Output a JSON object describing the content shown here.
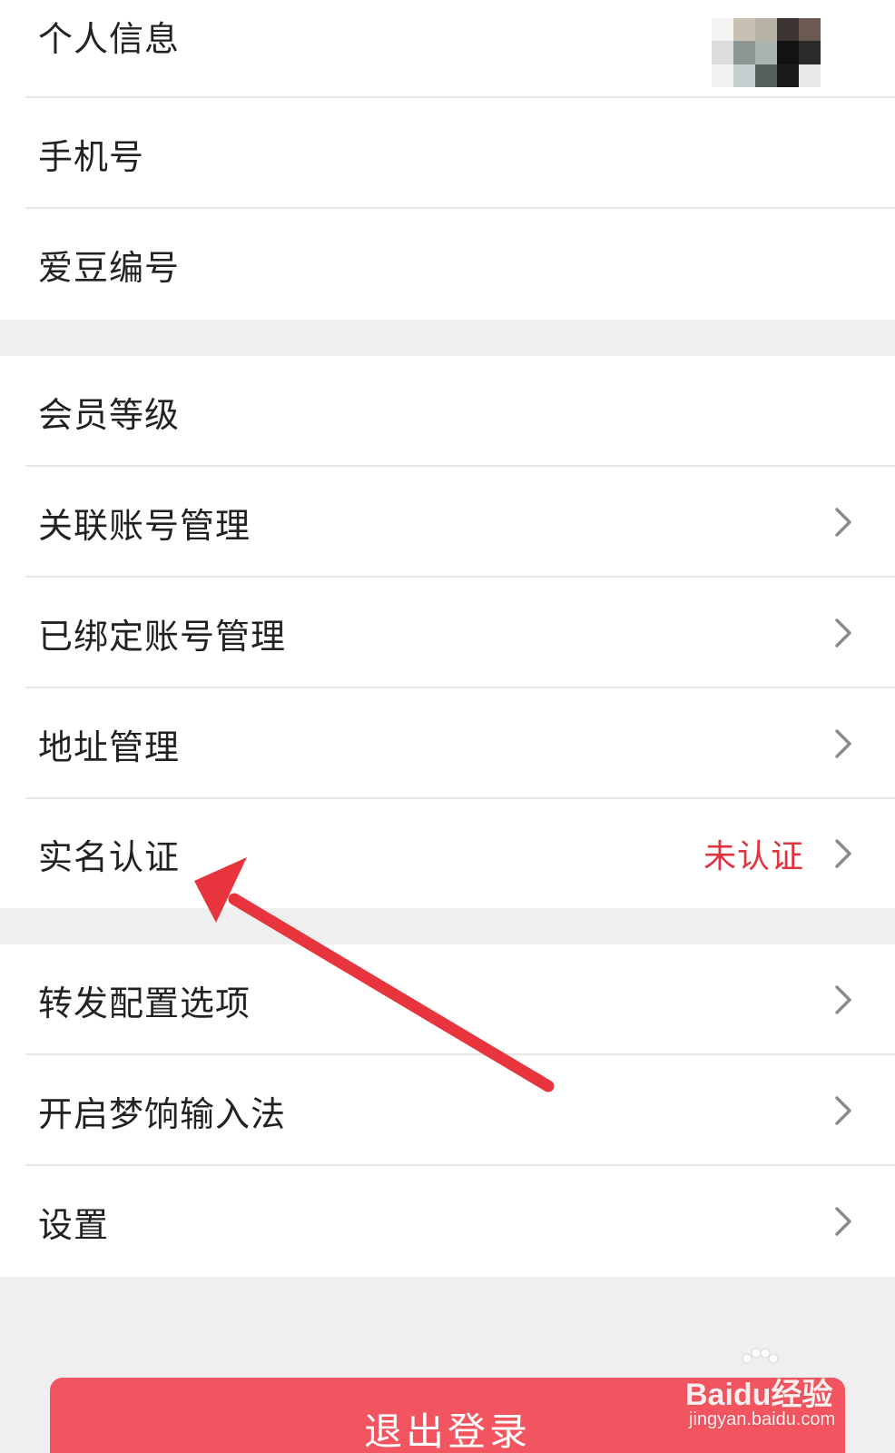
{
  "profile_section": {
    "items": [
      {
        "label": "个人信息"
      },
      {
        "label": "手机号"
      },
      {
        "label": "爱豆编号"
      }
    ]
  },
  "account_section": {
    "items": [
      {
        "label": "会员等级"
      },
      {
        "label": "关联账号管理"
      },
      {
        "label": "已绑定账号管理"
      },
      {
        "label": "地址管理"
      },
      {
        "label": "实名认证",
        "status": "未认证"
      }
    ]
  },
  "other_section": {
    "items": [
      {
        "label": "转发配置选项"
      },
      {
        "label": "开启梦饷输入法"
      },
      {
        "label": "设置"
      }
    ]
  },
  "logout_button": {
    "label": "退出登录"
  },
  "watermark": {
    "brand": "Baidu经验",
    "url": "jingyan.baidu.com"
  },
  "colors": {
    "status_red": "#e0333f",
    "logout_bg": "#f25560",
    "annotation_arrow": "#e8343c"
  },
  "icons": {
    "row_chevron": "chevron-right-icon",
    "annotation": "red-arrow-annotation"
  }
}
